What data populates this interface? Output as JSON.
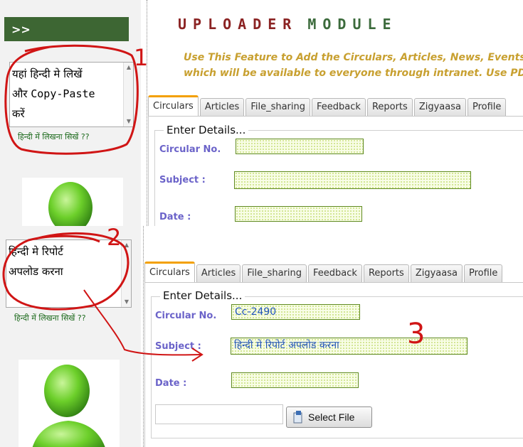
{
  "sidebar": {
    "arrow_label": ">>",
    "hindi_box_top": {
      "line1": "यहां हिन्दी मे लिखें",
      "line2a": "और ",
      "line2b": "Copy-Paste",
      "line3": "करें"
    },
    "hindi_box_bottom": {
      "line1": "हिन्दी मे रिपोर्ट",
      "line2": "अपलोड करना"
    },
    "learn_link": "हिन्दी में लिखना सिखें ??"
  },
  "header": {
    "title_word1": "UPLOADER",
    "title_word2": "MODULE",
    "desc_line1": "Use This Feature to Add the Circulars, Articles, News, Events, Re",
    "desc_line2": "which will be available to everyone through intranet. Use PDF W"
  },
  "tabs": [
    {
      "label": "Circulars",
      "active": true
    },
    {
      "label": "Articles"
    },
    {
      "label": "File_sharing"
    },
    {
      "label": "Feedback"
    },
    {
      "label": "Reports"
    },
    {
      "label": "Zigyaasa"
    },
    {
      "label": "Profile"
    }
  ],
  "form": {
    "legend": "Enter Details...",
    "circular_label": "Circular No.",
    "subject_label": "Subject :",
    "date_label": "Date :",
    "circular_value_bottom": "Cc-2490",
    "subject_value_bottom": "हिन्दी मे रिपोर्ट अपलोड करना",
    "select_file_label": "Select File"
  },
  "annotations": {
    "n1": "1",
    "n2": "2",
    "n3": "3"
  },
  "colors": {
    "annotation": "#d01515",
    "sidebar_bar": "#3d6633",
    "tab_active_border": "#f3a000",
    "label": "#6b63c9"
  }
}
